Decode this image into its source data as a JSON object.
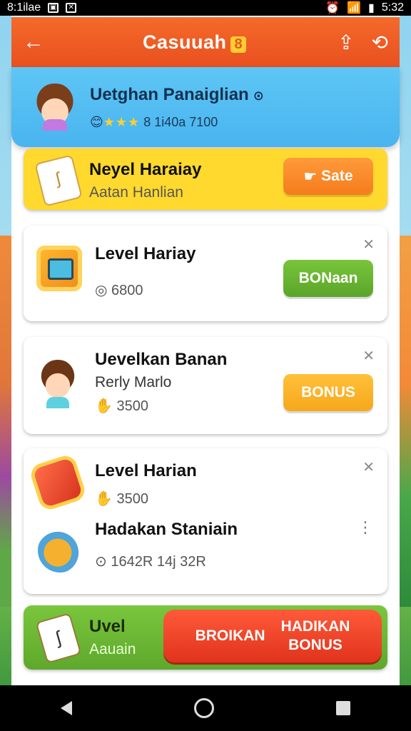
{
  "status": {
    "left_text": "8:1ilae",
    "time": "5:32"
  },
  "app_bar": {
    "title": "Casuuah",
    "coin": "8"
  },
  "profile": {
    "name": "Uetghan Panaiglian",
    "stats": "8 1i40a 7100"
  },
  "cards": {
    "promo": {
      "title": "Neyel Haraiay",
      "subtitle": "Aatan Hanlian",
      "button": "Sate"
    },
    "level1": {
      "title": "Level Hariay",
      "points": "6800",
      "button": "BONaan"
    },
    "level2": {
      "title": "Uevelkan Banan",
      "subtitle": "Rerly Marlo",
      "points": "3500",
      "button": "BONUS"
    },
    "level3": {
      "title": "Level Harian",
      "points": "3500",
      "title2": "Hadakan Staniain",
      "meta2": "1642R 14j 32R"
    },
    "bottom": {
      "title": "Uvel",
      "subtitle": "Aauain",
      "button_left": "BROIKAN",
      "button_right_1": "HADIKAN",
      "button_right_2": "BONUS"
    }
  }
}
